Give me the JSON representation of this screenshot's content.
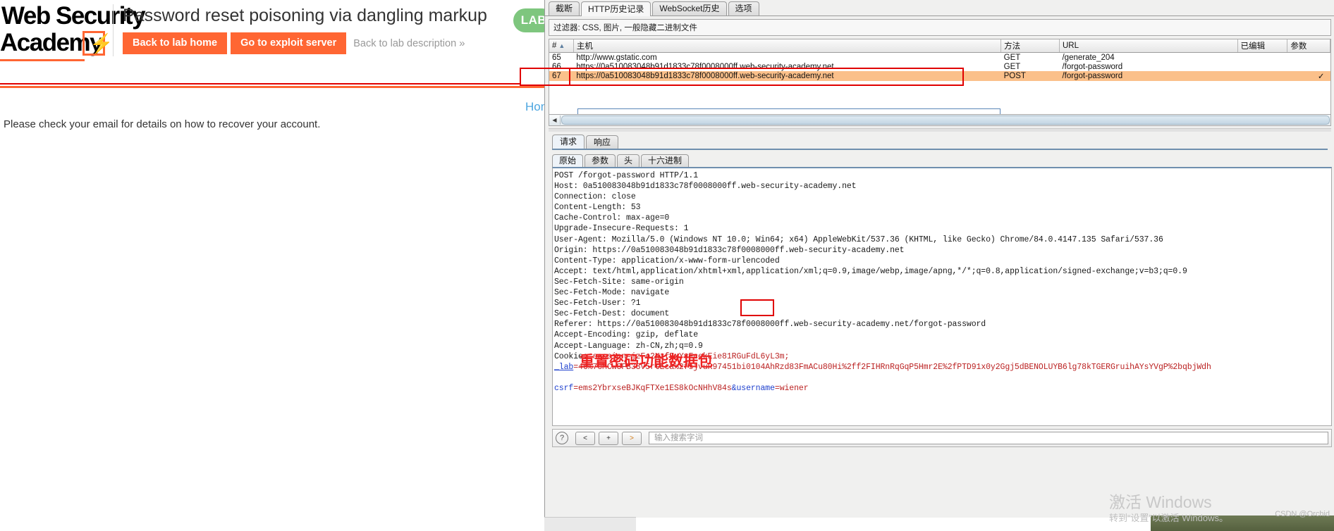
{
  "lab_page": {
    "logo": {
      "line1": "Web Security",
      "line2": "Academy",
      "bolt": "⚡"
    },
    "title": "Password reset poisoning via dangling markup",
    "buttons": {
      "back_to_lab_home": "Back to lab home",
      "go_to_exploit_server": "Go to exploit server",
      "back_to_lab_description": "Back to lab description",
      "chevron": "»"
    },
    "lab_badge": "LAB",
    "home_link": "Home",
    "body_text": "Please check your email for details on how to recover your account.",
    "accent_color": "#ff6633"
  },
  "burp": {
    "top_tabs": [
      {
        "label": "截断",
        "active": false
      },
      {
        "label": "HTTP历史记录",
        "active": true
      },
      {
        "label": "WebSocket历史",
        "active": false
      },
      {
        "label": "选项",
        "active": false
      }
    ],
    "filter_bar": "过滤器: CSS, 图片, 一般隐藏二进制文件",
    "table": {
      "columns": [
        "#",
        "主机",
        "方法",
        "URL",
        "已编辑",
        "参数"
      ],
      "sort_arrow": "▲",
      "rows": [
        {
          "num": "65",
          "host": "http://www.gstatic.com",
          "method": "GET",
          "url": "/generate_204",
          "edited": "",
          "params": "",
          "selected": false
        },
        {
          "num": "66",
          "host": "https://0a510083048b91d1833c78f0008000ff.web-security-academy.net",
          "method": "GET",
          "url": "/forgot-password",
          "edited": "",
          "params": "",
          "selected": false
        },
        {
          "num": "67",
          "host": "https://0a510083048b91d1833c78f0008000ff.web-security-academy.net",
          "method": "POST",
          "url": "/forgot-password",
          "edited": "",
          "params": "✓",
          "selected": true
        }
      ]
    },
    "scroll": {
      "left_arrow": "◀"
    },
    "rr_tabs": [
      {
        "label": "请求",
        "active": true
      },
      {
        "label": "响应",
        "active": false
      }
    ],
    "sub_tabs": [
      {
        "label": "原始",
        "active": true
      },
      {
        "label": "参数",
        "active": false
      },
      {
        "label": "头",
        "active": false
      },
      {
        "label": "十六进制",
        "active": false
      }
    ],
    "request_lines": [
      "POST /forgot-password HTTP/1.1",
      "Host: 0a510083048b91d1833c78f0008000ff.web-security-academy.net",
      "Connection: close",
      "Content-Length: 53",
      "Cache-Control: max-age=0",
      "Upgrade-Insecure-Requests: 1",
      "User-Agent: Mozilla/5.0 (Windows NT 10.0; Win64; x64) AppleWebKit/537.36 (KHTML, like Gecko) Chrome/84.0.4147.135 Safari/537.36",
      "Origin: https://0a510083048b91d1833c78f0008000ff.web-security-academy.net",
      "Content-Type: application/x-www-form-urlencoded",
      "Accept: text/html,application/xhtml+xml,application/xml;q=0.9,image/webp,image/apng,*/*;q=0.8,application/signed-exchange;v=b3;q=0.9",
      "Sec-Fetch-Site: same-origin",
      "Sec-Fetch-Mode: navigate",
      "Sec-Fetch-User: ?1",
      "Sec-Fetch-Dest: document",
      "Referer: https://0a510083048b91d1833c78f0008000ff.web-security-academy.net/forgot-password",
      "Accept-Encoding: gzip, deflate",
      "Accept-Language: zh-CN,zh;q=0.9"
    ],
    "cookie_label": "Cookie: ",
    "cookie_session": "session=jzFo2HzfFxYvFcekEie81RGuFdL6yL3m;",
    "cookie_lab_name": "_lab",
    "cookie_lab_value": "=46%7cMCwCFB38V5rtEca%2fsjvuR97451bi0104AhRzd83FmACu80Hi%2ff2FIHRnRqGqP5Hmr2E%2fPTD91x0y2Ggj5dBENOLUYB6lg78kTGERGruihAYsYVgP%2bqbjWdh",
    "body_csrf_key": "csrf",
    "body_csrf_value": "=ems2YbrxseBJKqFTXe1ES8kOcNHhV84s",
    "body_amp": "&",
    "body_username_key": "username",
    "body_username_value": "=wiener",
    "annotation_cn": "重置密码功能数据包",
    "bottom_bar": {
      "help_icon": "?",
      "prev_label": "<",
      "plus_label": "+",
      "next_label": ">",
      "search_placeholder": "输入搜索字词"
    },
    "annotation_color": "#e00000"
  },
  "watermark": {
    "line1": "激活 Windows",
    "line2": "转到“设置”以激活 Windows。",
    "csdn": "CSDN @Orchid"
  }
}
